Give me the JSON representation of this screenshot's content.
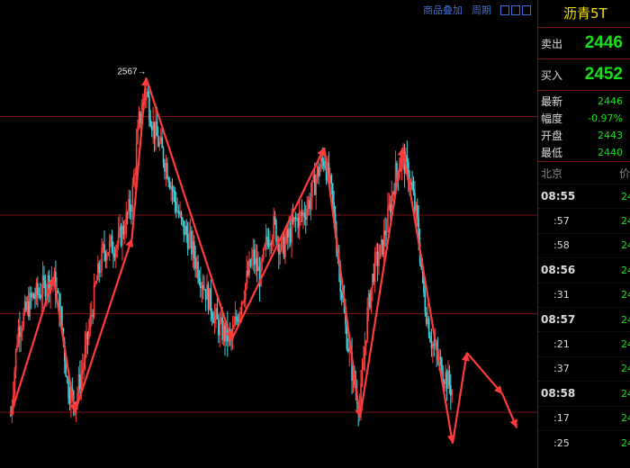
{
  "toolbar": {
    "overlay_label": "商品叠加",
    "period_label": "周期"
  },
  "chart_data": {
    "type": "line",
    "title": "",
    "annotation": "2567→",
    "line_color": "#ff3b3b",
    "zigzag_points": [
      [
        1,
        2437
      ],
      [
        7,
        2490
      ],
      [
        10,
        2438
      ],
      [
        18,
        2505
      ],
      [
        20,
        2567
      ],
      [
        32,
        2466
      ],
      [
        45,
        2540
      ],
      [
        50,
        2436
      ],
      [
        56,
        2540
      ],
      [
        63,
        2426
      ],
      [
        65,
        2461
      ],
      [
        70,
        2445
      ],
      [
        72,
        2432
      ]
    ],
    "price_series": [
      [
        1,
        2437
      ],
      [
        2,
        2470
      ],
      [
        3,
        2476
      ],
      [
        4,
        2482
      ],
      [
        5,
        2484
      ],
      [
        6,
        2488
      ],
      [
        7,
        2490
      ],
      [
        8,
        2476
      ],
      [
        9,
        2448
      ],
      [
        10,
        2442
      ],
      [
        11,
        2454
      ],
      [
        12,
        2470
      ],
      [
        13,
        2488
      ],
      [
        14,
        2500
      ],
      [
        15,
        2502
      ],
      [
        16,
        2503
      ],
      [
        17,
        2510
      ],
      [
        18,
        2520
      ],
      [
        19,
        2550
      ],
      [
        20,
        2562
      ],
      [
        21,
        2548
      ],
      [
        22,
        2540
      ],
      [
        23,
        2532
      ],
      [
        24,
        2520
      ],
      [
        25,
        2510
      ],
      [
        26,
        2505
      ],
      [
        27,
        2496
      ],
      [
        28,
        2488
      ],
      [
        29,
        2480
      ],
      [
        30,
        2472
      ],
      [
        31,
        2468
      ],
      [
        32,
        2466
      ],
      [
        33,
        2478
      ],
      [
        34,
        2488
      ],
      [
        35,
        2498
      ],
      [
        36,
        2490
      ],
      [
        37,
        2505
      ],
      [
        38,
        2510
      ],
      [
        39,
        2500
      ],
      [
        40,
        2506
      ],
      [
        41,
        2512
      ],
      [
        42,
        2514
      ],
      [
        43,
        2520
      ],
      [
        44,
        2530
      ],
      [
        45,
        2536
      ],
      [
        46,
        2522
      ],
      [
        47,
        2496
      ],
      [
        48,
        2470
      ],
      [
        49,
        2452
      ],
      [
        50,
        2440
      ],
      [
        51,
        2475
      ],
      [
        52,
        2494
      ],
      [
        53,
        2500
      ],
      [
        54,
        2514
      ],
      [
        55,
        2530
      ],
      [
        56,
        2536
      ],
      [
        57,
        2528
      ],
      [
        58,
        2512
      ],
      [
        59,
        2482
      ],
      [
        60,
        2466
      ],
      [
        61,
        2458
      ],
      [
        62,
        2452
      ],
      [
        63,
        2446
      ]
    ],
    "y_range": [
      2420,
      2590
    ],
    "x_range": [
      0,
      74
    ],
    "grid_levels": [
      2552,
      2514,
      2476,
      2438
    ],
    "grid_color": "#7a1010",
    "up_color": "#ff4040",
    "down_color": "#38d6e0"
  },
  "panel": {
    "title": "沥青5T",
    "sell_label": "卖出",
    "sell_price": "2446",
    "buy_label": "买入",
    "buy_price": "2452",
    "stats": [
      {
        "label": "最新",
        "value": "2446"
      },
      {
        "label": "幅度",
        "value": "-0.97%"
      },
      {
        "label": "开盘",
        "value": "2443"
      },
      {
        "label": "最低",
        "value": "2440"
      }
    ],
    "table_header": {
      "time": "北京",
      "price": "价"
    },
    "ticks": [
      {
        "time": "08:55",
        "price": "24"
      },
      {
        "time": ":57",
        "price": "24"
      },
      {
        "time": ":58",
        "price": "24"
      },
      {
        "time": "08:56",
        "price": "24"
      },
      {
        "time": ":31",
        "price": "24"
      },
      {
        "time": "08:57",
        "price": "24"
      },
      {
        "time": ":21",
        "price": "24"
      },
      {
        "time": ":37",
        "price": "24"
      },
      {
        "time": "08:58",
        "price": "24"
      },
      {
        "time": ":17",
        "price": "24"
      },
      {
        "time": ":25",
        "price": "24"
      }
    ]
  }
}
